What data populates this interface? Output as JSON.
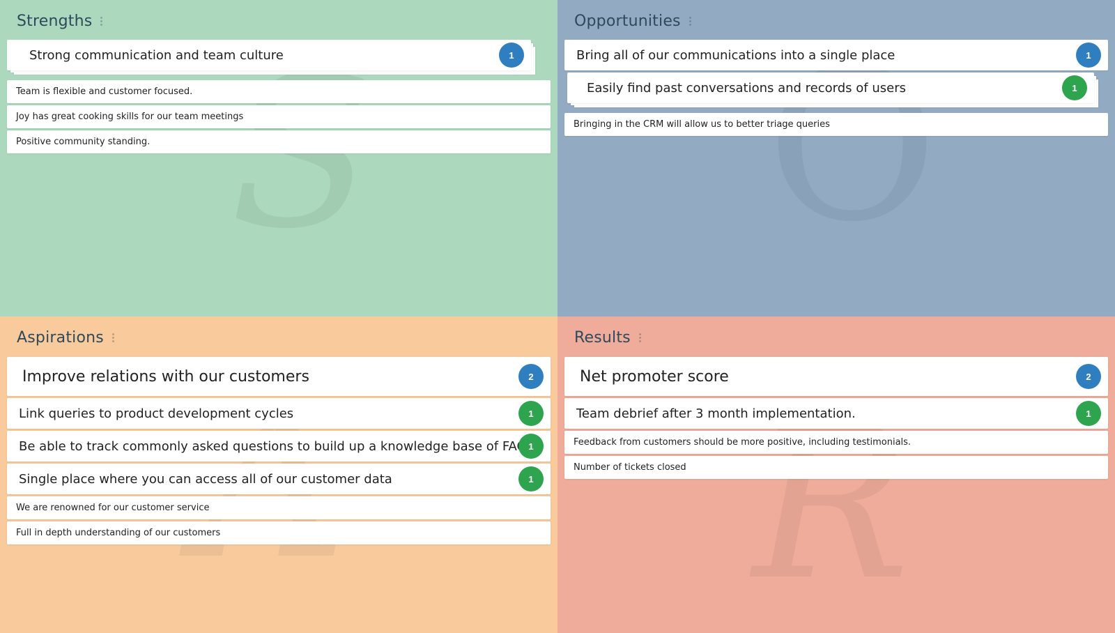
{
  "colors": {
    "strengths": "#acd9be",
    "opportunities": "#92abc3",
    "aspirations": "#f9ca9c",
    "results": "#f0ac9a",
    "badge_blue": "#2f7fc0",
    "badge_green": "#2ea44f"
  },
  "quadrants": {
    "strengths": {
      "title": "Strengths",
      "watermark": "S",
      "cards": [
        {
          "text": "Strong communication and team culture",
          "votes": "1"
        },
        {
          "text": "Team is flexible and customer focused."
        },
        {
          "text": "Joy has great cooking skills for our team meetings"
        },
        {
          "text": "Positive community standing."
        }
      ]
    },
    "opportunities": {
      "title": "Opportunities",
      "watermark": "O",
      "cards": [
        {
          "text": "Bring all of our communications into a single place",
          "votes": "1"
        },
        {
          "text": "Easily find past conversations and records of users",
          "votes": "1"
        },
        {
          "text": "Bringing in the CRM will allow us to better triage queries"
        }
      ]
    },
    "aspirations": {
      "title": "Aspirations",
      "watermark": "A",
      "cards": [
        {
          "text": "Improve relations with our customers",
          "votes": "2"
        },
        {
          "text": "Link queries to product development cycles",
          "votes": "1"
        },
        {
          "text": "Be able to track commonly asked questions to build up a knowledge base of FAQ's",
          "votes": "1"
        },
        {
          "text": "Single place where you can access all of our customer data",
          "votes": "1"
        },
        {
          "text": "We are renowned for our customer service"
        },
        {
          "text": "Full in depth understanding of our customers"
        }
      ]
    },
    "results": {
      "title": "Results",
      "watermark": "R",
      "cards": [
        {
          "text": "Net promoter score",
          "votes": "2"
        },
        {
          "text": "Team debrief after 3 month implementation.",
          "votes": "1"
        },
        {
          "text": "Feedback from customers should be more positive, including testimonials."
        },
        {
          "text": "Number of tickets closed"
        }
      ]
    }
  }
}
